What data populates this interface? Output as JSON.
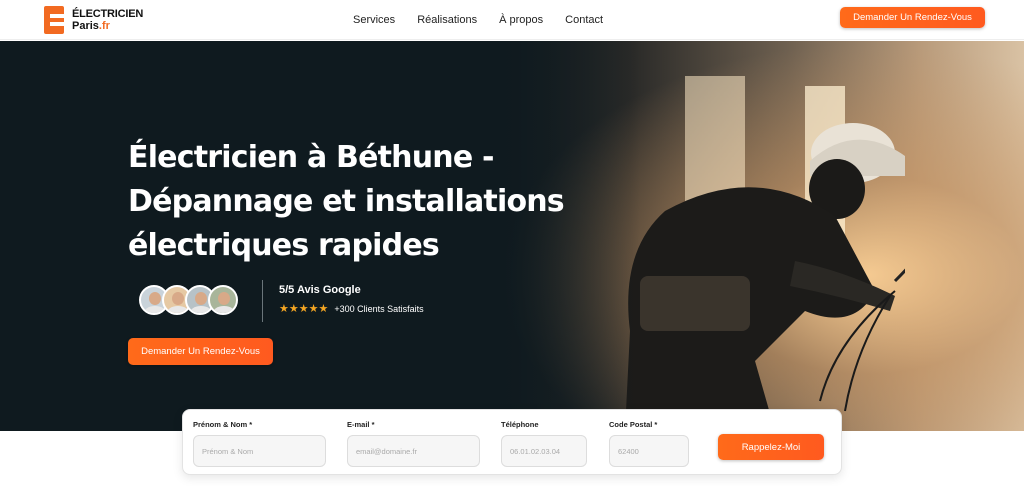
{
  "header": {
    "logo_main": "ÉLECTRICIEN",
    "logo_sub": "Paris",
    "logo_tld": ".fr",
    "nav": [
      "Services",
      "Réalisations",
      "À propos",
      "Contact"
    ],
    "cta": "Demander Un Rendez-Vous"
  },
  "hero": {
    "title": "Électricien à Béthune - Dépannage et installations électriques rapides",
    "rating_title": "5/5 Avis Google",
    "stars": "★★★★★",
    "clients": "+300 Clients Satisfaits",
    "cta": "Demander Un Rendez-Vous"
  },
  "form": {
    "name_label": "Prénom & Nom *",
    "name_placeholder": "Prénom & Nom",
    "email_label": "E-mail *",
    "email_placeholder": "email@domaine.fr",
    "phone_label": "Téléphone",
    "phone_placeholder": "06.01.02.03.04",
    "postal_label": "Code Postal *",
    "postal_placeholder": "62400",
    "submit": "Rappelez-Moi"
  },
  "colors": {
    "accent": "#ff5f1f",
    "hero_bg": "#0f1a1f"
  }
}
